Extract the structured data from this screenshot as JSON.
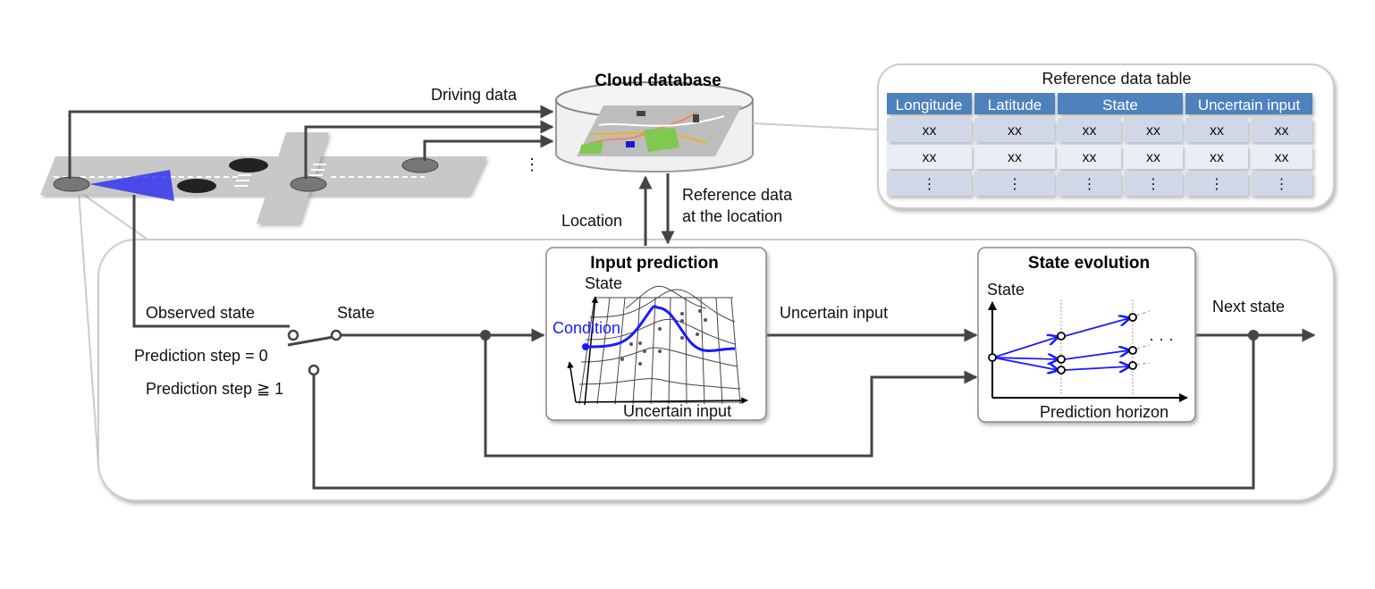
{
  "cloud": {
    "title": "Cloud database",
    "driving_data": "Driving data",
    "location": "Location",
    "reference_line1": "Reference data",
    "reference_line2": "at the location",
    "more": "⋮"
  },
  "table": {
    "title": "Reference data table",
    "headers": [
      "Longitude",
      "Latitude",
      "State",
      "Uncertain input"
    ],
    "rows": [
      [
        "xx",
        "xx",
        "xx",
        "xx",
        "xx",
        "xx"
      ],
      [
        "xx",
        "xx",
        "xx",
        "xx",
        "xx",
        "xx"
      ],
      [
        "⋮",
        "⋮",
        "⋮",
        "⋮",
        "⋮",
        "⋮"
      ]
    ]
  },
  "switch": {
    "observed_state": "Observed state",
    "state": "State",
    "step0": "Prediction step = 0",
    "step1": "Prediction step ≧ 1"
  },
  "input_prediction": {
    "title": "Input prediction",
    "y_label": "State",
    "condition": "Condition",
    "x_label": "Uncertain input"
  },
  "uncertain_input": "Uncertain input",
  "state_evolution": {
    "title": "State evolution",
    "y_label": "State",
    "x_label": "Prediction horizon",
    "more": "· · ·"
  },
  "next_state": "Next state",
  "colors": {
    "accent_blue": "#1a1aff",
    "table_header": "#4f81bd",
    "table_row_dark": "#d0d8e8",
    "table_row_light": "#e9edf4",
    "wire": "#444444"
  }
}
